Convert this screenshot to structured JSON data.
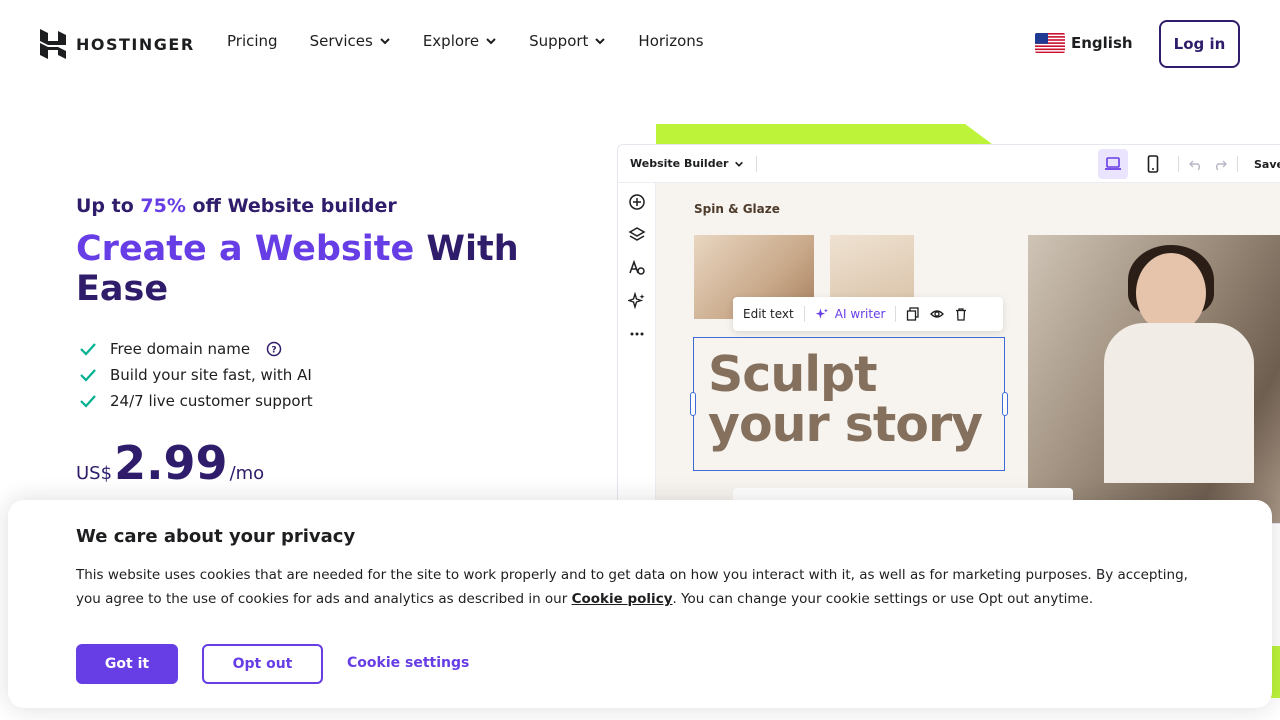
{
  "header": {
    "logo_text": "HOSTINGER",
    "nav": [
      {
        "label": "Pricing",
        "has_dropdown": false
      },
      {
        "label": "Services",
        "has_dropdown": true
      },
      {
        "label": "Explore",
        "has_dropdown": true
      },
      {
        "label": "Support",
        "has_dropdown": true
      },
      {
        "label": "Horizons",
        "has_dropdown": false
      }
    ],
    "language": "English",
    "login_label": "Log in"
  },
  "hero": {
    "promo_prefix": "Up to ",
    "promo_accent": "75%",
    "promo_suffix": " off Website builder",
    "title_accent": "Create a Website",
    "title_rest": " With Ease",
    "features": [
      "Free domain name",
      "Build your site fast, with AI",
      "24/7 live customer support"
    ],
    "price_currency": "US$",
    "price_amount": "2.99",
    "price_period": "/mo"
  },
  "builder": {
    "title": "Website Builder",
    "save_label": "Save",
    "site_name": "Spin & Glaze",
    "edit_text_label": "Edit text",
    "ai_writer_label": "AI writer",
    "headline_line1": "Sculpt",
    "headline_line2": "your story"
  },
  "cookie": {
    "title": "We care about your privacy",
    "text_before_link": "This website uses cookies that are needed for the site to work properly and to get data on how you interact with it, as well as for marketing purposes. By accepting, you agree to the use of cookies for ads and analytics as described in our ",
    "link_label": "Cookie policy",
    "text_after_link": ". You can change your cookie settings or use Opt out anytime.",
    "accept_label": "Got it",
    "opt_out_label": "Opt out",
    "settings_label": "Cookie settings"
  },
  "colors": {
    "brand_purple": "#673de6",
    "dark_purple": "#2f1c6a",
    "lime": "#bdf43a",
    "check_green": "#00b090"
  }
}
